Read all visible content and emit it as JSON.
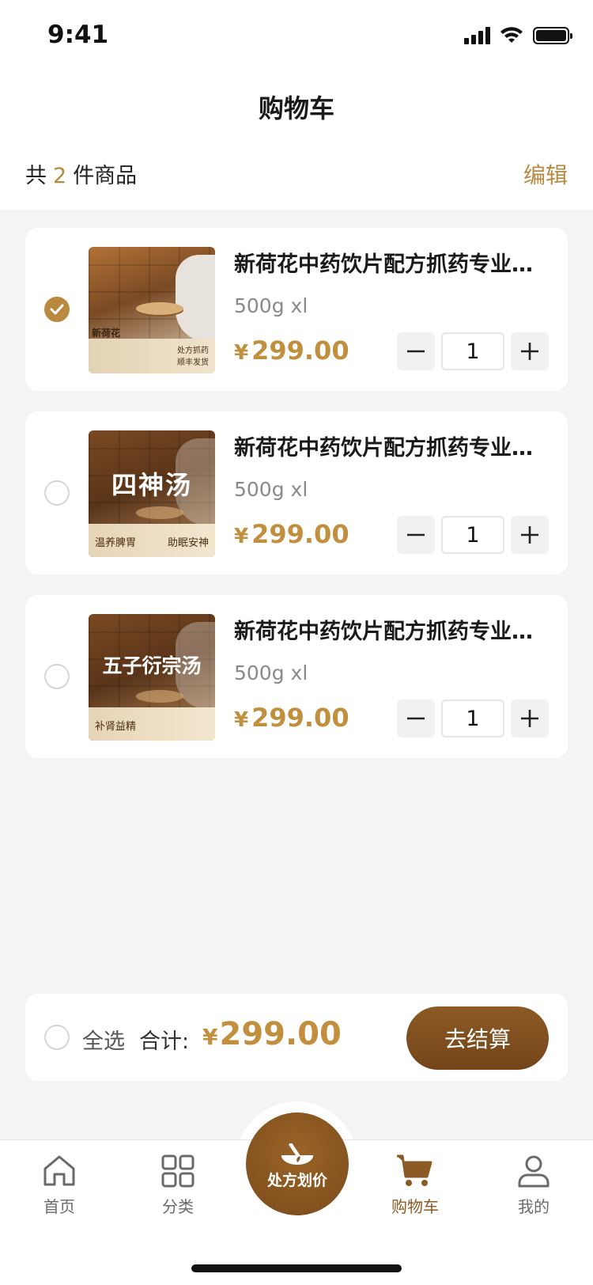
{
  "status_bar": {
    "time": "9:41"
  },
  "header": {
    "title": "购物车",
    "count_prefix": "共",
    "count": "2",
    "count_suffix": "件商品",
    "edit_label": "编辑"
  },
  "cart_items": [
    {
      "checked": true,
      "image_brand": "新荷花",
      "image_title": "",
      "image_tags": [
        "处方抓药",
        "顺丰发货"
      ],
      "name": "新荷花中药饮片配方抓药专业代煎中药材...",
      "spec": "500g xl",
      "currency": "¥",
      "price": "299.00",
      "quantity": "1"
    },
    {
      "checked": false,
      "image_brand": "",
      "image_title": "四神汤",
      "image_tags": [
        "温养脾胃",
        "助眠安神"
      ],
      "name": "新荷花中药饮片配方抓药专业代煎中药材...",
      "spec": "500g xl",
      "currency": "¥",
      "price": "299.00",
      "quantity": "1"
    },
    {
      "checked": false,
      "image_brand": "",
      "image_title": "五子衍宗汤",
      "image_tags": [
        "补肾益精",
        ""
      ],
      "name": "新荷花中药饮片配方抓药专业代煎中药材...",
      "spec": "500g xl",
      "currency": "¥",
      "price": "299.00",
      "quantity": "1"
    }
  ],
  "checkout": {
    "select_all_label": "全选",
    "total_label": "合计:",
    "currency": "¥",
    "total": "299.00",
    "pay_label": "去结算"
  },
  "tabbar": {
    "items": [
      {
        "label": "首页",
        "icon": "home-icon"
      },
      {
        "label": "分类",
        "icon": "category-grid-icon"
      },
      {
        "label": "处方划价",
        "icon": "mortar-icon"
      },
      {
        "label": "购物车",
        "icon": "cart-icon",
        "active": true
      },
      {
        "label": "我的",
        "icon": "user-icon"
      }
    ]
  },
  "colors": {
    "accent": "#c28f3f",
    "brand_brown": "#8c5a24",
    "background": "#f4f4f4"
  }
}
